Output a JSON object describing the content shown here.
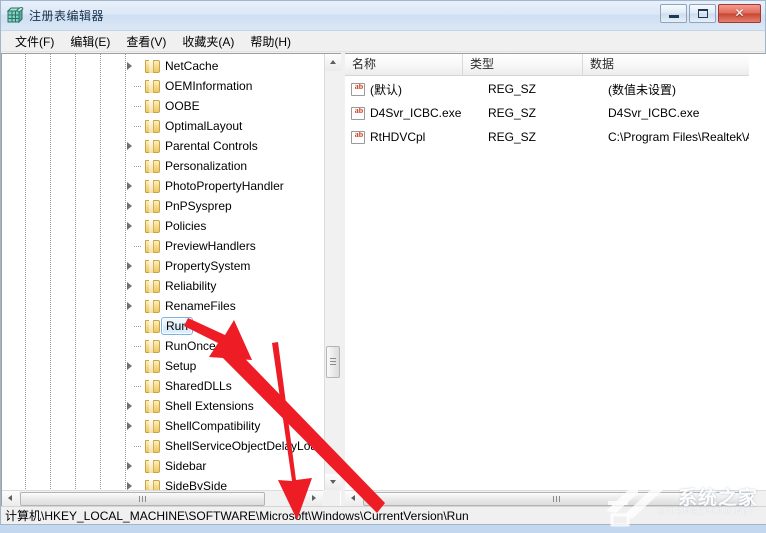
{
  "window": {
    "title": "注册表编辑器",
    "icon": "registry-editor-icon",
    "controls": {
      "minimize_label": "–",
      "maximize_label": "□",
      "close_label": "✕"
    }
  },
  "menubar": {
    "items": [
      {
        "label": "文件(F)",
        "name": "menu-file"
      },
      {
        "label": "编辑(E)",
        "name": "menu-edit"
      },
      {
        "label": "查看(V)",
        "name": "menu-view"
      },
      {
        "label": "收藏夹(A)",
        "name": "menu-favorites"
      },
      {
        "label": "帮助(H)",
        "name": "menu-help"
      }
    ]
  },
  "tree": {
    "nodes": [
      {
        "label": "NetCache",
        "expandable": true,
        "selected": false
      },
      {
        "label": "OEMInformation",
        "expandable": false,
        "selected": false
      },
      {
        "label": "OOBE",
        "expandable": false,
        "selected": false
      },
      {
        "label": "OptimalLayout",
        "expandable": false,
        "selected": false
      },
      {
        "label": "Parental Controls",
        "expandable": true,
        "selected": false
      },
      {
        "label": "Personalization",
        "expandable": false,
        "selected": false
      },
      {
        "label": "PhotoPropertyHandler",
        "expandable": true,
        "selected": false
      },
      {
        "label": "PnPSysprep",
        "expandable": true,
        "selected": false
      },
      {
        "label": "Policies",
        "expandable": true,
        "selected": false
      },
      {
        "label": "PreviewHandlers",
        "expandable": false,
        "selected": false
      },
      {
        "label": "PropertySystem",
        "expandable": true,
        "selected": false
      },
      {
        "label": "Reliability",
        "expandable": true,
        "selected": false
      },
      {
        "label": "RenameFiles",
        "expandable": true,
        "selected": false
      },
      {
        "label": "Run",
        "expandable": false,
        "selected": true
      },
      {
        "label": "RunOnce",
        "expandable": false,
        "selected": false
      },
      {
        "label": "Setup",
        "expandable": true,
        "selected": false
      },
      {
        "label": "SharedDLLs",
        "expandable": false,
        "selected": false
      },
      {
        "label": "Shell Extensions",
        "expandable": true,
        "selected": false
      },
      {
        "label": "ShellCompatibility",
        "expandable": true,
        "selected": false
      },
      {
        "label": "ShellServiceObjectDelayLoad",
        "expandable": false,
        "selected": false
      },
      {
        "label": "Sidebar",
        "expandable": true,
        "selected": false
      },
      {
        "label": "SideBySide",
        "expandable": true,
        "selected": false
      }
    ]
  },
  "list": {
    "columns": [
      "名称",
      "类型",
      "数据"
    ],
    "rows": [
      {
        "name": "(默认)",
        "type": "REG_SZ",
        "data": "(数值未设置)"
      },
      {
        "name": "D4Svr_ICBC.exe",
        "type": "REG_SZ",
        "data": "D4Svr_ICBC.exe"
      },
      {
        "name": "RtHDVCpl",
        "type": "REG_SZ",
        "data": "C:\\Program Files\\Realtek\\Au"
      }
    ]
  },
  "statusbar": {
    "path": "计算机\\HKEY_LOCAL_MACHINE\\SOFTWARE\\Microsoft\\Windows\\CurrentVersion\\Run"
  },
  "annotations": {
    "arrow_color": "#ee1c24",
    "arrow_to_run": "arrow-pointing-to-run-key",
    "arrow_to_path": "arrow-pointing-to-status-path"
  },
  "watermark": {
    "text": "系统之家",
    "subtext": "XITONGZHIJIA.NET"
  }
}
